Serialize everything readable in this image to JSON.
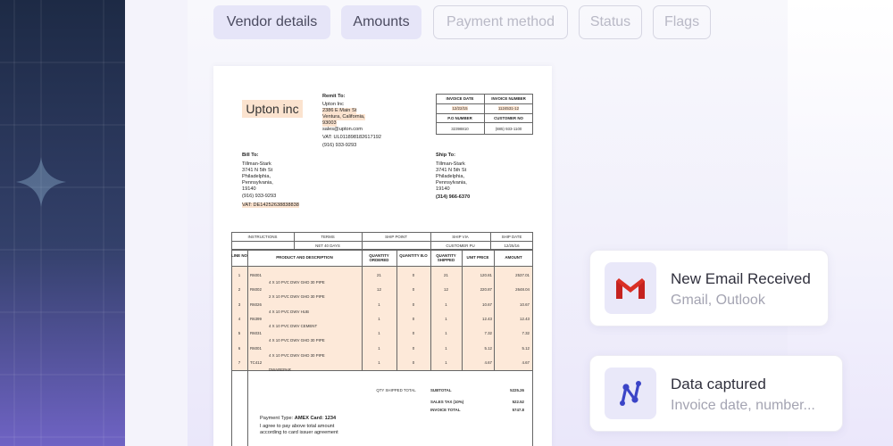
{
  "tabs": [
    {
      "label": "Vendor details",
      "state": "active"
    },
    {
      "label": "Amounts",
      "state": "active"
    },
    {
      "label": "Payment method",
      "state": "inactive"
    },
    {
      "label": "Status",
      "state": "inactive"
    },
    {
      "label": "Flags",
      "state": "inactive"
    }
  ],
  "invoice": {
    "company_logo": "Upton inc",
    "remit_to": {
      "label": "Remit To:",
      "lines": [
        "Upton Inc",
        "2386 E Main St",
        "Ventura, California,",
        "93003",
        "sales@upton.com",
        "VAT: UL011898182617192",
        "(916) 933-9293"
      ]
    },
    "header_table": {
      "invoice_date_label": "INVOICE DATE",
      "invoice_number_label": "INVOICE NUMBER",
      "invoice_date": "12/22/15",
      "invoice_number": "1124531-12",
      "po_number_label": "P.O NUMBER",
      "customer_no_label": "CUSTOMER NO",
      "po_number": "32398810",
      "customer_no": "(885) 933-1100"
    },
    "bill_to": {
      "label": "Bill To:",
      "lines": [
        "Tillman-Stark",
        "3741 N 5th St",
        "Philadelphia,",
        "Pennsylvania,",
        "19140",
        "(916) 933-9293"
      ],
      "vat": "VAT: DE14252638838838"
    },
    "ship_to": {
      "label": "Ship To:",
      "lines": [
        "Tillman-Stark",
        "3741 N 5th St",
        "Philadelphia,",
        "Pennsylvania,",
        "19140"
      ],
      "phone": "(314) 966-6370"
    },
    "terms_table": {
      "headers": [
        "INSTRUCTIONS",
        "TERMS",
        "SHIP POINT",
        "SHIP VIA",
        "SHIP DATE"
      ],
      "values": [
        "",
        "NET 40 DAYS",
        "",
        "CUSTOMER PU",
        "12/25/16"
      ]
    },
    "items_headers": [
      "LINE NO",
      "PRODUCT AND DESCRIPTION",
      "QUANTITY ORDERED",
      "QUANTITY B.O",
      "QUANTITY SHIPPED",
      "UNIT PRICE",
      "AMOUNT"
    ],
    "items": [
      {
        "line": "1",
        "code": "R6001",
        "desc": "4 X 10 PVC DWV GHD 30 PIPE",
        "ordered": "21",
        "bo": "0",
        "shipped": "21",
        "price": "120.81",
        "amount": "2537.01"
      },
      {
        "line": "2",
        "code": "R6002",
        "desc": "2 X 10 PVC DWV GHD 30 PIPE",
        "ordered": "12",
        "bo": "0",
        "shipped": "12",
        "price": "220.87",
        "amount": "2648.04"
      },
      {
        "line": "3",
        "code": "R6026",
        "desc": "4 X 10 PVC DWV HUB",
        "ordered": "1",
        "bo": "0",
        "shipped": "1",
        "price": "10.67",
        "amount": "10.67"
      },
      {
        "line": "4",
        "code": "R6399",
        "desc": "4 X 10 PVC DWV CEMENT",
        "ordered": "1",
        "bo": "0",
        "shipped": "1",
        "price": "12.43",
        "amount": "12.43"
      },
      {
        "line": "5",
        "code": "R6031",
        "desc": "4 X 10 PVC DWV GHD 30 PIPE",
        "ordered": "1",
        "bo": "0",
        "shipped": "1",
        "price": "7.32",
        "amount": "7.32"
      },
      {
        "line": "6",
        "code": "R6001",
        "desc": "4 X 10 PVC DWV GHD 30 PIPE",
        "ordered": "1",
        "bo": "0",
        "shipped": "1",
        "price": "5.12",
        "amount": "5.12"
      },
      {
        "line": "7",
        "code": "TC412",
        "desc": "DWAREPAR",
        "ordered": "1",
        "bo": "0",
        "shipped": "1",
        "price": "4.67",
        "amount": "4.67"
      }
    ],
    "qty_shipped_total_label": "QTY SHIPPED TOTAL",
    "subtotal_label": "SUBTOTAL",
    "subtotal": "5225.26",
    "sales_tax_label": "SALES TAX (10%)",
    "sales_tax": "522.52",
    "invoice_total_label": "INVOICE TOTAL",
    "invoice_total": "5747.8",
    "payment_type_label": "Payment Type:",
    "payment_type": "AMEX Card: 1234",
    "agreement": [
      "I agree to pay above total amount",
      "according to card issuer agreement"
    ]
  },
  "cards": [
    {
      "title": "New Email Received",
      "subtitle": "Gmail, Outlook",
      "icon": "gmail-icon"
    },
    {
      "title": "Data captured",
      "subtitle": "Invoice date, number...",
      "icon": "nanonets-icon"
    }
  ],
  "colors": {
    "highlight": "#fbe3cf",
    "tab_active": "#e6e5f8",
    "left_panel": "#1d2a45",
    "gmail_red": "#d93025",
    "logo_blue": "#3b44c7"
  }
}
